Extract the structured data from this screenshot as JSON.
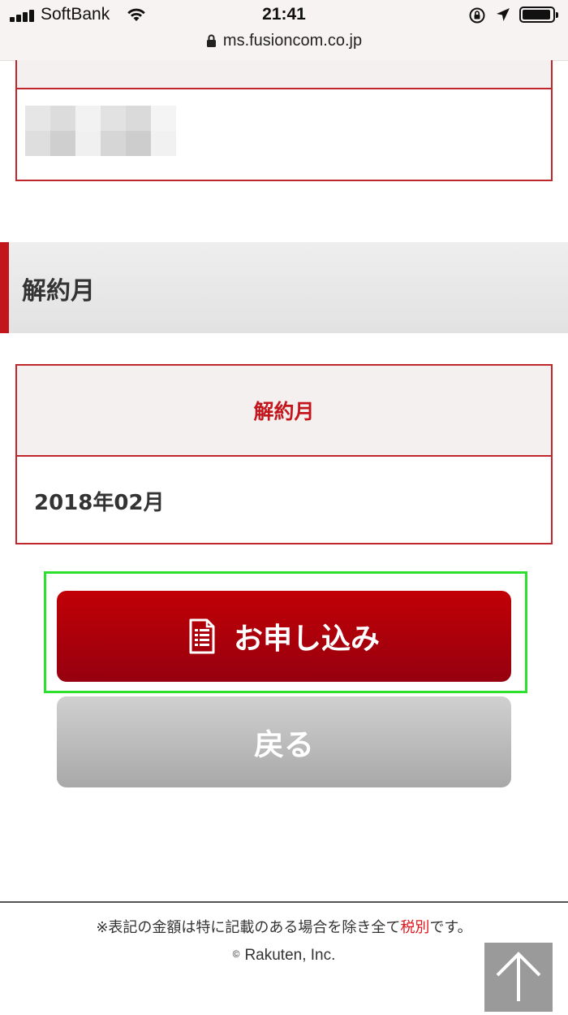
{
  "status_bar": {
    "carrier": "SoftBank",
    "time": "21:41",
    "icons": [
      "signal-icon",
      "wifi-icon",
      "rotation-lock-icon",
      "location-icon",
      "battery-icon"
    ]
  },
  "browser": {
    "url": "ms.fusioncom.co.jp",
    "icons": [
      "lock-icon"
    ]
  },
  "section": {
    "heading": "解約月"
  },
  "cancellation_table": {
    "header": "解約月",
    "value": "2018年02月"
  },
  "buttons": {
    "apply_label": "お申し込み",
    "apply_icon": "document-icon",
    "back_label": "戻る"
  },
  "footer": {
    "note_before": "※表記の金額は特に記載のある場合を除き全て",
    "note_highlight": "税別",
    "note_after": "です。",
    "copyright_symbol": "©",
    "copyright": "Rakuten, Inc.",
    "back_to_top_icon": "arrow-up-icon"
  },
  "colors": {
    "accent_red": "#c3161c",
    "button_red": "#b00008",
    "button_gray": "#bdbdbd",
    "highlight_green": "#2ee02e",
    "note_red": "#e0151c"
  }
}
